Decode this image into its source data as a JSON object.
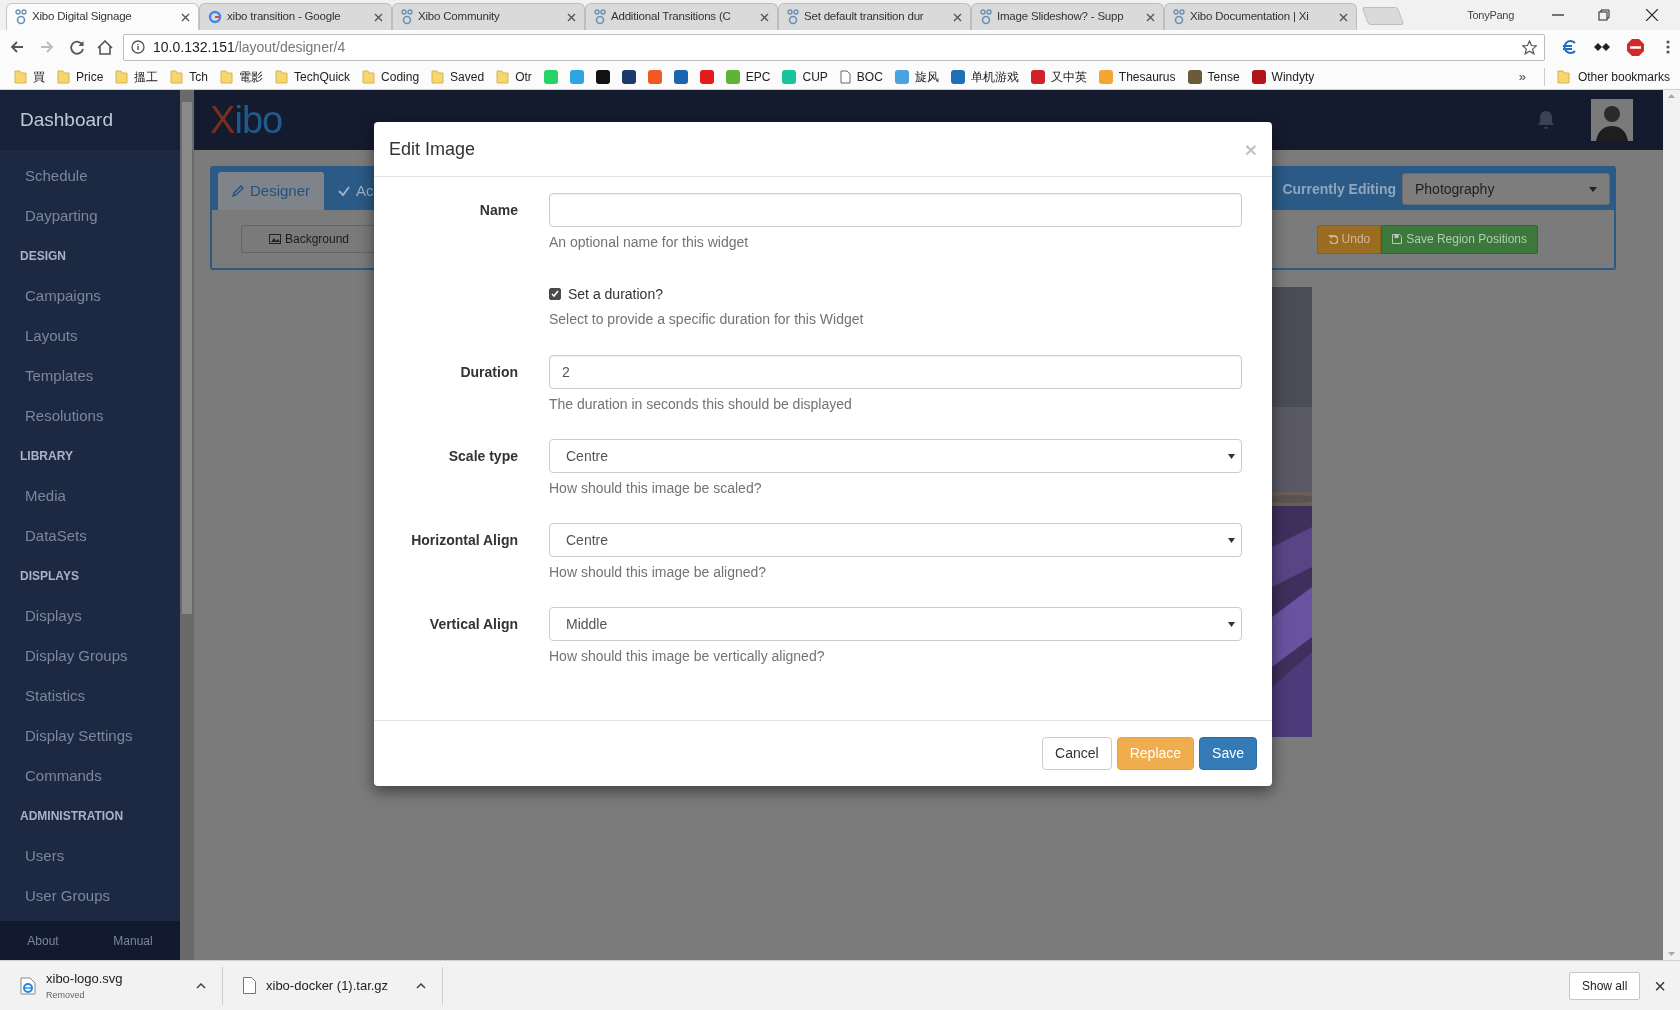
{
  "browser": {
    "tabs": [
      {
        "kind": "xibo",
        "title": "Xibo Digital Signage",
        "selected": true
      },
      {
        "kind": "google",
        "title": "xibo transition - Google",
        "selected": false
      },
      {
        "kind": "xibo",
        "title": "Xibo Community",
        "selected": false
      },
      {
        "kind": "xibo",
        "title": "Additional Transitions (C",
        "selected": false
      },
      {
        "kind": "xibo",
        "title": "Set default transition dur",
        "selected": false
      },
      {
        "kind": "xibo",
        "title": "Image Slideshow? - Supp",
        "selected": false
      },
      {
        "kind": "xibo",
        "title": "Xibo Documentation | Xi",
        "selected": false
      }
    ],
    "profile": "TonyPang",
    "url_host": "10.0.132.151",
    "url_path": "/layout/designer/4",
    "bookmarks": [
      {
        "kind": "folder",
        "label": "買"
      },
      {
        "kind": "folder",
        "label": "Price"
      },
      {
        "kind": "folder",
        "label": "搵工"
      },
      {
        "kind": "folder",
        "label": "Tch"
      },
      {
        "kind": "folder",
        "label": "電影"
      },
      {
        "kind": "folder",
        "label": "TechQuick"
      },
      {
        "kind": "folder",
        "label": "Coding"
      },
      {
        "kind": "folder",
        "label": "Saved"
      },
      {
        "kind": "folder",
        "label": "Otr"
      },
      {
        "kind": "site",
        "color": "#25d366"
      },
      {
        "kind": "site",
        "color": "#2ca5e0"
      },
      {
        "kind": "site",
        "color": "#111111"
      },
      {
        "kind": "site",
        "color": "#1a3a6b"
      },
      {
        "kind": "site",
        "color": "#f05a22"
      },
      {
        "kind": "site",
        "color": "#1b64b0"
      },
      {
        "kind": "site",
        "color": "#e21b1b"
      },
      {
        "kind": "site",
        "color": "#5fb336",
        "label": "EPC"
      },
      {
        "kind": "site",
        "color": "#19c39b",
        "label": "CUP"
      },
      {
        "kind": "page",
        "label": "BOC"
      },
      {
        "kind": "site",
        "color": "#4aa3df",
        "label": "旋风"
      },
      {
        "kind": "site",
        "color": "#1f6fb6",
        "label": "单机游戏"
      },
      {
        "kind": "site",
        "color": "#d1232a",
        "label": "又中英"
      },
      {
        "kind": "site",
        "color": "#f3a62f",
        "label": "Thesaurus"
      },
      {
        "kind": "site",
        "color": "#6b5a3a",
        "label": "Tense"
      },
      {
        "kind": "site",
        "color": "#b3141c",
        "label": "Windyty"
      }
    ],
    "more": "»",
    "other_bookmarks": "Other bookmarks"
  },
  "sidebar": {
    "title": "Dashboard",
    "items": [
      {
        "kind": "link",
        "label": "Schedule"
      },
      {
        "kind": "link",
        "label": "Dayparting"
      },
      {
        "kind": "section",
        "label": "DESIGN"
      },
      {
        "kind": "link",
        "label": "Campaigns"
      },
      {
        "kind": "link",
        "label": "Layouts"
      },
      {
        "kind": "link",
        "label": "Templates"
      },
      {
        "kind": "link",
        "label": "Resolutions"
      },
      {
        "kind": "section",
        "label": "LIBRARY"
      },
      {
        "kind": "link",
        "label": "Media"
      },
      {
        "kind": "link",
        "label": "DataSets"
      },
      {
        "kind": "section",
        "label": "DISPLAYS"
      },
      {
        "kind": "link",
        "label": "Displays"
      },
      {
        "kind": "link",
        "label": "Display Groups"
      },
      {
        "kind": "link",
        "label": "Statistics"
      },
      {
        "kind": "link",
        "label": "Display Settings"
      },
      {
        "kind": "link",
        "label": "Commands"
      },
      {
        "kind": "section",
        "label": "ADMINISTRATION"
      },
      {
        "kind": "link",
        "label": "Users"
      },
      {
        "kind": "link",
        "label": "User Groups"
      }
    ],
    "footer": [
      "About",
      "Manual"
    ]
  },
  "header": {
    "logo": "Xibo"
  },
  "designer": {
    "tabs": [
      {
        "label": "Designer",
        "selected": true
      },
      {
        "label": "Ac",
        "selected": false
      }
    ],
    "background_button": "Background",
    "currently_editing": "Currently Editing",
    "layout_select": "Photography",
    "undo": "Undo",
    "save_regions": "Save Region Positions"
  },
  "modal": {
    "title": "Edit Image",
    "close": "×",
    "fields": [
      {
        "kind": "text",
        "label": "Name",
        "help": "An optional name for this widget"
      },
      {
        "kind": "checkbox",
        "label": "Set a duration?",
        "checked": true,
        "help": "Select to provide a specific duration for this Widget"
      },
      {
        "kind": "text",
        "label": "Duration",
        "value": "2",
        "help": "The duration in seconds this should be displayed"
      },
      {
        "kind": "select",
        "label": "Scale type",
        "value": "Centre",
        "help": "How should this image be scaled?"
      },
      {
        "kind": "select",
        "label": "Horizontal Align",
        "value": "Centre",
        "help": "How should this image be aligned?"
      },
      {
        "kind": "select",
        "label": "Vertical Align",
        "value": "Middle",
        "help": "How should this image be vertically aligned?"
      }
    ],
    "buttons": [
      {
        "kind": "default",
        "label": "Cancel"
      },
      {
        "kind": "warning",
        "label": "Replace"
      },
      {
        "kind": "primary",
        "label": "Save"
      }
    ]
  },
  "downloads": {
    "items": [
      {
        "name": "xibo-logo.svg",
        "status": "Removed",
        "kind": "web"
      },
      {
        "name": "xibo-docker (1).tar.gz",
        "kind": "file"
      }
    ],
    "show_all": "Show all",
    "close": "×"
  }
}
